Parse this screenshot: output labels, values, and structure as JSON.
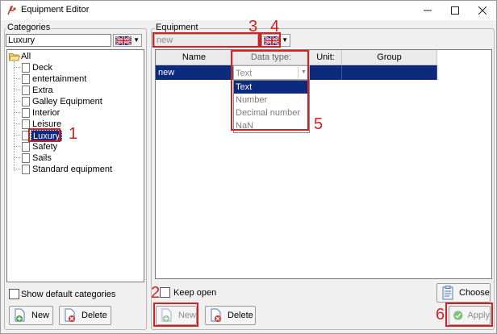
{
  "window": {
    "title": "Equipment Editor",
    "min": "—",
    "max": "☐",
    "close": "✕"
  },
  "categories": {
    "group_label": "Categories",
    "search_value": "Luxury",
    "tree": {
      "root": "All",
      "items": [
        "Deck",
        "entertainment",
        "Extra",
        "Galley Equipment",
        "Interior",
        "Leisure",
        "Luxury",
        "Safety",
        "Sails",
        "Standard equipment"
      ],
      "selected": "Luxury"
    },
    "show_default_label": "Show default categories",
    "new_label": "New",
    "delete_label": "Delete"
  },
  "equipment": {
    "group_label": "Equipment",
    "name_placeholder": "new",
    "columns": [
      "Name",
      "Data type:",
      "Unit:",
      "Group"
    ],
    "row": {
      "name": "new",
      "data_type": "Text",
      "unit": "",
      "group": ""
    },
    "data_type_options": [
      "Text",
      "Number",
      "Decimal number",
      "NaN"
    ],
    "keep_open_label": "Keep open",
    "choose_label": "Choose",
    "new_label": "New",
    "delete_label": "Delete",
    "apply_label": "Apply"
  },
  "annotations": [
    "1",
    "2",
    "3",
    "4",
    "5",
    "6"
  ],
  "colors": {
    "highlight": "#0c2a7e",
    "annotation": "#d32020",
    "apply_icon": "#4caf50",
    "delete_icon": "#d32f2f",
    "new_icon": "#43a047"
  }
}
